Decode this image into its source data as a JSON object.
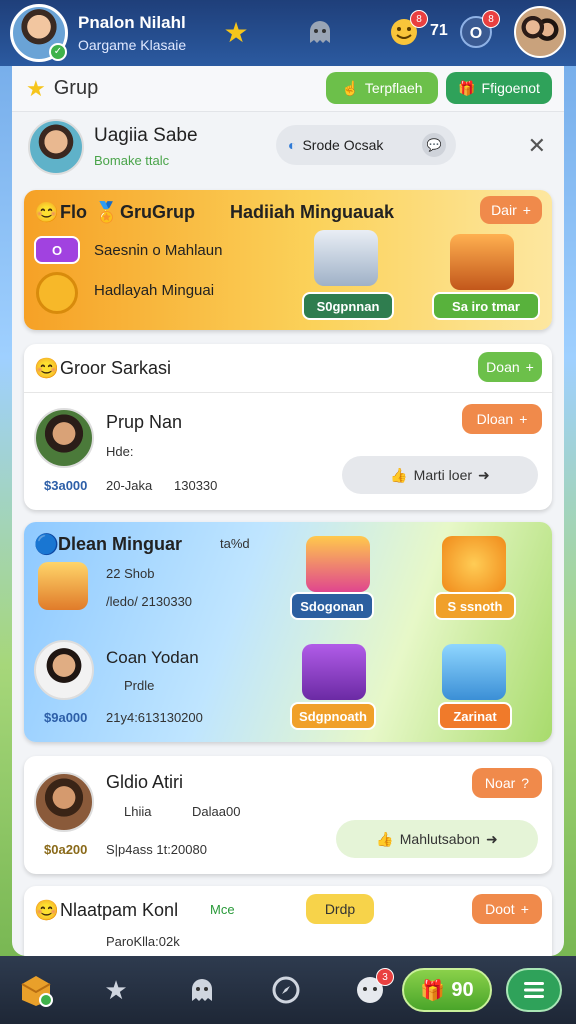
{
  "topbar": {
    "user_name": "Pnalon Nilahl",
    "user_sub": "Oargame Klasaie",
    "count": "71",
    "badge_messages": "8",
    "badge_notify": "8",
    "icons": [
      "star-icon",
      "ghost-icon",
      "emoji-icon",
      "profile-icon"
    ]
  },
  "panel": {
    "title": "Grup",
    "btn_left": "Terpflaeh",
    "btn_right": "Ffigoenot",
    "user": {
      "name": "Uagiia Sabe",
      "sub": "Bomake ttalc"
    },
    "search_placeholder": "Srode Ocsak"
  },
  "event_card": {
    "title_left": "Flo",
    "title_group": "GruGrup",
    "title_main": "Hadiiah Minguauak",
    "cta": "Dair",
    "line1_tag": "O",
    "line1": "Saesnin o Mahlaun",
    "line2": "Hadlayah Minguai",
    "reward1": "S0gpnnan",
    "reward2": "Sa iro tmar"
  },
  "group_card": {
    "title": "Groor Sarkasi",
    "btn": "Doan",
    "member": {
      "name": "Prup Nan",
      "sub": "Hde:",
      "score": "$3a000",
      "stats": "20-Jaka",
      "stats2": "130330"
    },
    "action_btn": "Dloan",
    "message_btn": "Marti loer"
  },
  "weekly_card": {
    "title": "Dlean Minguar",
    "title_tag": "ta%d",
    "row1_title": "22 Shob",
    "row1_sub": "/ledo/ 2130330",
    "member_name": "Coan Yodan",
    "member_sub": "Prdle",
    "member_score": "$9a000",
    "member_stats": "21y4:613130200",
    "reward1": "Sdogonan",
    "reward2": "S ssnoth",
    "reward3": "Sdgpnoath",
    "reward4": "Zarinat"
  },
  "member_card": {
    "name": "Gldio Atiri",
    "tag1": "Lhiia",
    "tag2": "Dalaa00",
    "score": "$0a200",
    "stats": "S|p4ass 1t:20080",
    "btn": "Noar",
    "message_btn": "Mahlutsabon"
  },
  "last_card": {
    "name": "Nlaatpam Konl",
    "tag": "Mce",
    "btn_mid": "Drdp",
    "btn": "Doot",
    "sub": "ParoKlla:02k"
  },
  "bottomnav": {
    "coins": "90",
    "items": [
      "home-icon",
      "star-icon",
      "ghost-icon",
      "compass-icon",
      "chat-icon"
    ],
    "badge": "3"
  }
}
